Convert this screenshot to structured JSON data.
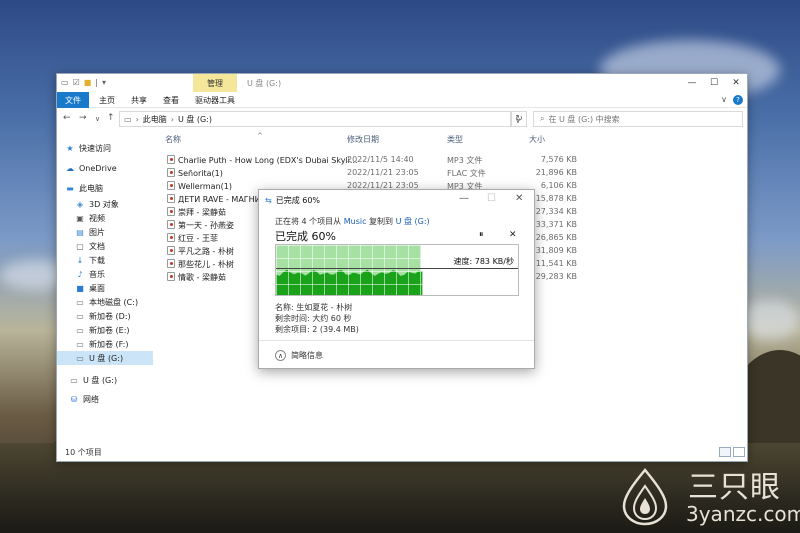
{
  "window": {
    "quick_access": [
      "☑",
      "📁",
      "|",
      "▾"
    ],
    "manage_tab": "管理",
    "title": "U 盘 (G:)",
    "controls": [
      "—",
      "☐",
      "✕"
    ]
  },
  "ribbon": {
    "tabs": [
      "文件",
      "主页",
      "共享",
      "查看",
      "驱动器工具"
    ],
    "right": [
      "∨",
      "?"
    ]
  },
  "navbar": {
    "path": [
      "此电脑",
      "U 盘 (G:)"
    ],
    "search_placeholder": "在 U 盘 (G:) 中搜索"
  },
  "sidebar": {
    "items": [
      {
        "label": "快速访问",
        "icon": "star-icon"
      },
      {
        "label": "OneDrive",
        "icon": "cloud-icon"
      },
      {
        "label": "此电脑",
        "icon": "computer-icon"
      },
      {
        "label": "3D 对象",
        "icon": "cube-icon"
      },
      {
        "label": "视频",
        "icon": "video-icon"
      },
      {
        "label": "图片",
        "icon": "picture-icon"
      },
      {
        "label": "文档",
        "icon": "document-icon"
      },
      {
        "label": "下载",
        "icon": "download-icon"
      },
      {
        "label": "音乐",
        "icon": "music-icon"
      },
      {
        "label": "桌面",
        "icon": "desktop-icon"
      },
      {
        "label": "本地磁盘 (C:)",
        "icon": "drive-icon"
      },
      {
        "label": "新加卷 (D:)",
        "icon": "drive-icon"
      },
      {
        "label": "新加卷 (E:)",
        "icon": "drive-icon"
      },
      {
        "label": "新加卷 (F:)",
        "icon": "drive-icon"
      },
      {
        "label": "U 盘 (G:)",
        "icon": "usb-drive-icon"
      },
      {
        "label": "U 盘 (G:)",
        "icon": "usb-drive-icon"
      },
      {
        "label": "网络",
        "icon": "network-icon"
      }
    ]
  },
  "columns": [
    "名称",
    "修改日期",
    "类型",
    "大小"
  ],
  "files": [
    {
      "name": "Charlie Puth - How Long (EDX's Dubai Skyli...",
      "date": "2022/11/5 14:40",
      "type": "MP3 文件",
      "size": "7,576 KB"
    },
    {
      "name": "Señorita(1)",
      "date": "2022/11/21 23:05",
      "type": "FLAC 文件",
      "size": "21,896 KB"
    },
    {
      "name": "Wellerman(1)",
      "date": "2022/11/21 23:05",
      "type": "MP3 文件",
      "size": "6,106 KB"
    },
    {
      "name": "ДЕТИ RAVE - МАГНИТ",
      "date": "",
      "type": "",
      "size": "15,878 KB"
    },
    {
      "name": "崇拜 - 梁静茹",
      "date": "",
      "type": "",
      "size": "27,334 KB"
    },
    {
      "name": "第一天 - 孙燕姿",
      "date": "",
      "type": "",
      "size": "33,371 KB"
    },
    {
      "name": "红豆 - 王菲",
      "date": "",
      "type": "",
      "size": "26,865 KB"
    },
    {
      "name": "平凡之路 - 朴树",
      "date": "",
      "type": "",
      "size": "31,809 KB"
    },
    {
      "name": "那些花儿 - 朴树",
      "date": "",
      "type": "",
      "size": "11,541 KB"
    },
    {
      "name": "情歌 - 梁静茹",
      "date": "",
      "type": "",
      "size": "29,283 KB"
    }
  ],
  "status": {
    "item_count": "10 个项目"
  },
  "dialog": {
    "title": "已完成 60%",
    "controls": [
      "—",
      "☐",
      "✕"
    ],
    "copy_prefix": "正在将 4 个项目从 ",
    "source": "Music",
    "copy_mid": " 复制到 ",
    "destination": "U 盘 (G:)",
    "heading": "已完成 60%",
    "pause_label": "⏸",
    "cancel_label": "✕",
    "progress_percent": 60,
    "speed": "速度: 783 KB/秒",
    "name_line": "名称: 生如夏花 - 朴树",
    "time_line": "剩余时间: 大约 60 秒",
    "items_line": "剩余项目: 2 (39.4 MB)",
    "fewer_details": "简略信息"
  },
  "watermark": {
    "brand": "三只眼",
    "url": "3yanzc.com"
  }
}
